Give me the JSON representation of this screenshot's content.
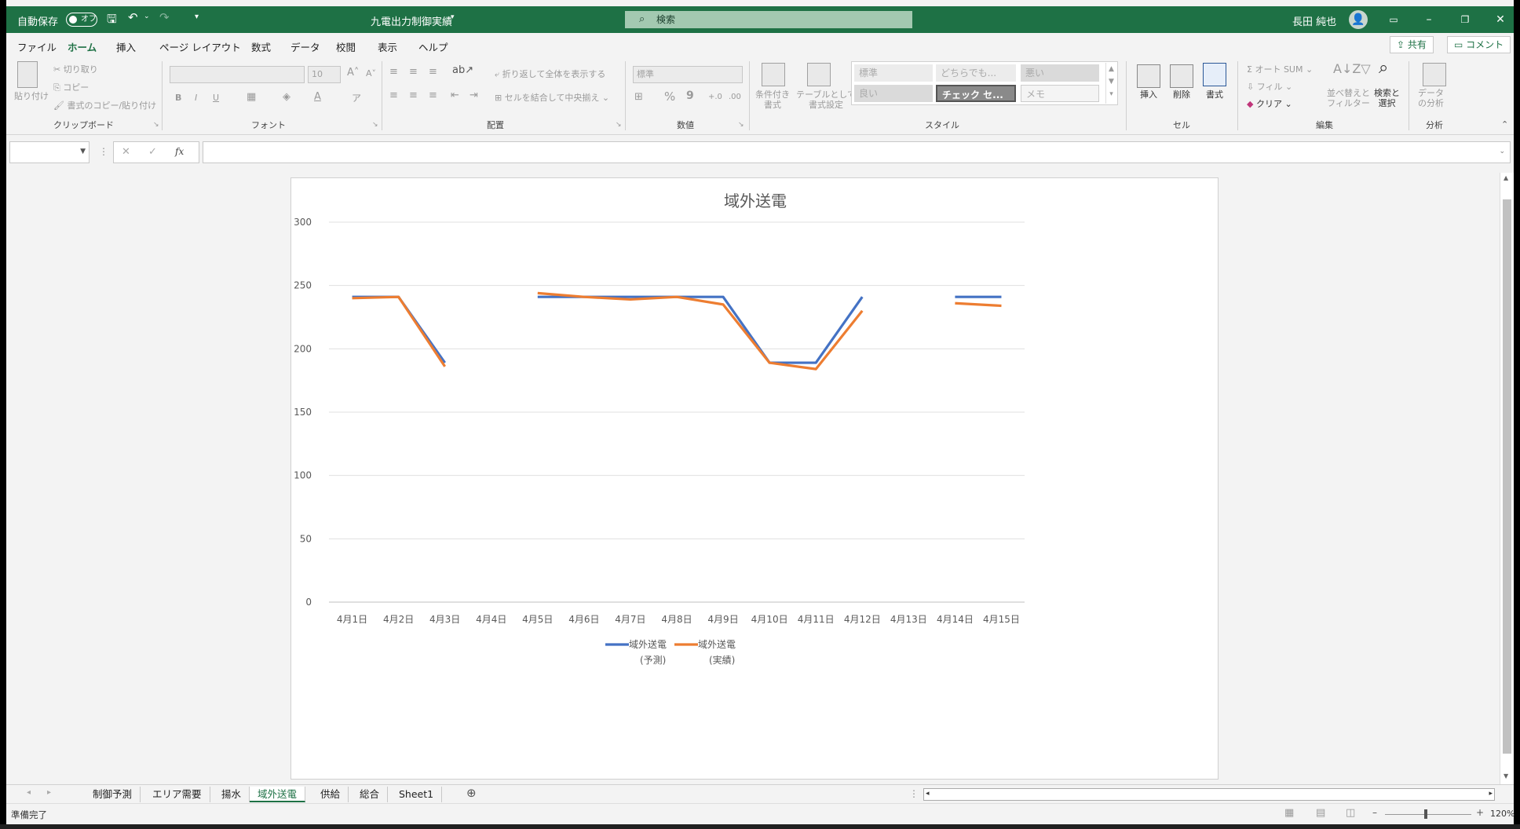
{
  "titlebar": {
    "autosave_label": "自動保存",
    "autosave_state": "オフ",
    "document_title": "九電出力制御実績",
    "search_placeholder": "検索",
    "user_name": "長田 純也"
  },
  "menu": {
    "items": [
      "ファイル",
      "ホーム",
      "挿入",
      "ページ レイアウト",
      "数式",
      "データ",
      "校閲",
      "表示",
      "ヘルプ"
    ],
    "active": "ホーム",
    "share_label": "共有",
    "comment_label": "コメント"
  },
  "ribbon": {
    "clipboard": {
      "label": "クリップボード",
      "paste": "貼り付け",
      "cut": "切り取り",
      "copy": "コピー",
      "format_painter": "書式のコピー/貼り付け"
    },
    "font": {
      "label": "フォント",
      "size": "10",
      "bold": "B",
      "italic": "I",
      "underline": "U"
    },
    "alignment": {
      "label": "配置",
      "wrap": "折り返して全体を表示する",
      "merge": "セルを結合して中央揃え"
    },
    "number": {
      "label": "数値",
      "format": "標準",
      "percent": "%",
      "comma": "9"
    },
    "styles": {
      "label": "スタイル",
      "conditional": "条件付き\n書式",
      "table": "テーブルとして\n書式設定",
      "cells": [
        "標準",
        "どちらでも...",
        "悪い",
        "良い",
        "チェック セ...",
        "メモ"
      ]
    },
    "cells": {
      "label": "セル",
      "insert": "挿入",
      "delete": "削除",
      "format": "書式"
    },
    "editing": {
      "label": "編集",
      "autosum": "オート SUM",
      "fill": "フィル",
      "clear": "クリア",
      "sort": "並べ替えと\nフィルター",
      "find": "検索と\n選択"
    },
    "analysis": {
      "label": "分析",
      "data_analysis": "データ\nの分析"
    }
  },
  "formula": {
    "fx": "fx",
    "value": ""
  },
  "chart_data": {
    "type": "line",
    "title": "域外送電",
    "categories": [
      "4月1日",
      "4月2日",
      "4月3日",
      "4月4日",
      "4月5日",
      "4月6日",
      "4月7日",
      "4月8日",
      "4月9日",
      "4月10日",
      "4月11日",
      "4月12日",
      "4月13日",
      "4月14日",
      "4月15日"
    ],
    "ylim": [
      0,
      300
    ],
    "yticks": [
      0,
      50,
      100,
      150,
      200,
      250,
      300
    ],
    "grid": true,
    "legend_position": "bottom",
    "series": [
      {
        "name": "域外送電\n(予測)",
        "color": "#4472c4",
        "values": [
          241,
          241,
          189,
          null,
          241,
          241,
          241,
          241,
          241,
          189,
          189,
          241,
          null,
          241,
          241
        ]
      },
      {
        "name": "域外送電\n(実績)",
        "color": "#ed7d31",
        "values": [
          240,
          241,
          186,
          null,
          244,
          241,
          239,
          241,
          235,
          189,
          184,
          230,
          null,
          236,
          234
        ]
      }
    ]
  },
  "sheets": {
    "tabs": [
      "制御予測",
      "エリア需要",
      "揚水",
      "域外送電",
      "供給",
      "総合",
      "Sheet1"
    ],
    "active": "域外送電"
  },
  "status": {
    "text": "準備完了",
    "zoom": "120%"
  }
}
